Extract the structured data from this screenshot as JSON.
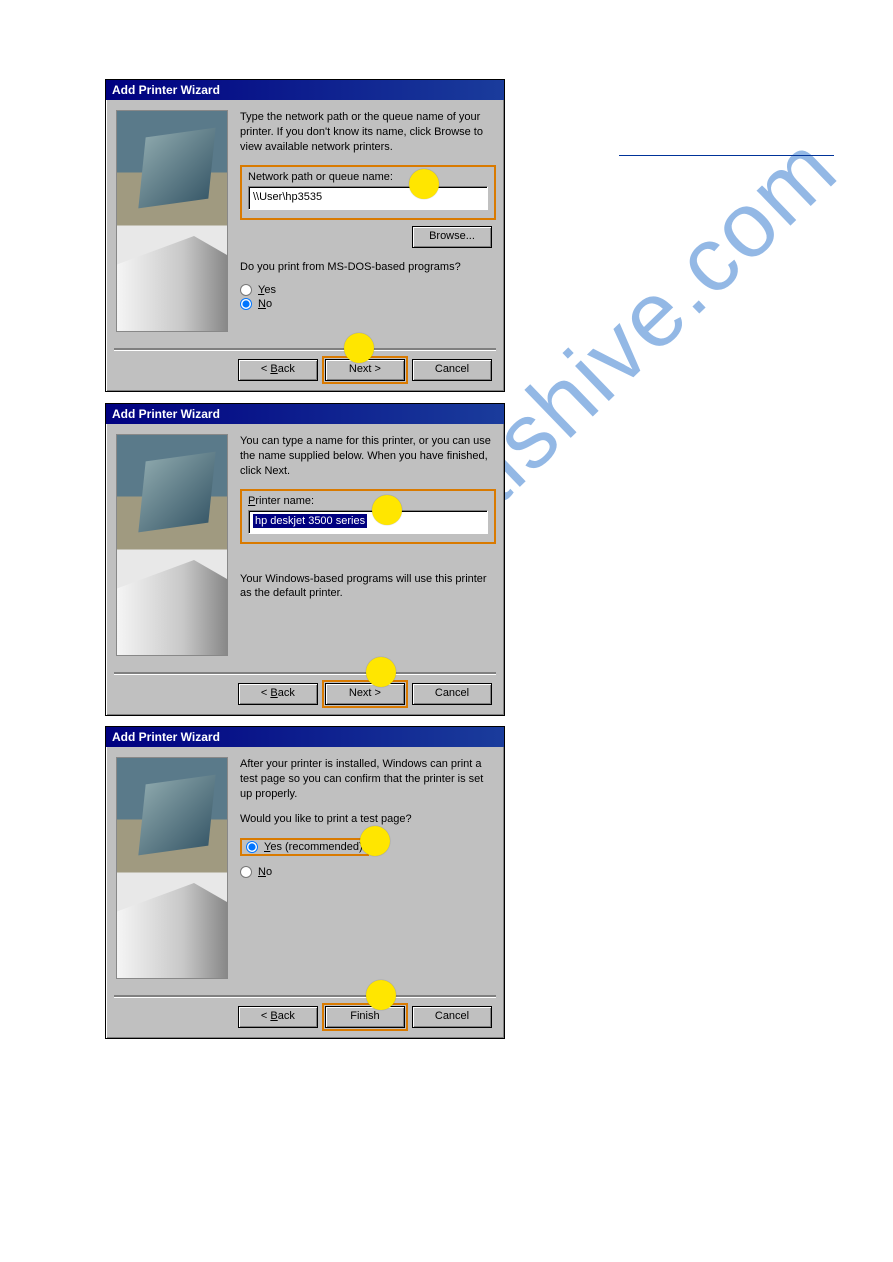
{
  "watermark": "manualshive.com",
  "dialogs": [
    {
      "title": "Add Printer Wizard",
      "desc": "Type the network path or the queue name of your printer. If you don't know its name, click Browse to view available network printers.",
      "field_label": "Network path or queue name:",
      "field_value": "\\\\User\\hp3535",
      "browse": "Browse...",
      "question": "Do you print from MS-DOS-based programs?",
      "radio_yes": "Yes",
      "radio_no": "No",
      "back": "< Back",
      "next": "Next >",
      "cancel": "Cancel"
    },
    {
      "title": "Add Printer Wizard",
      "desc": "You can type a name for this printer, or you can use the name supplied below. When you have finished, click Next.",
      "field_label": "Printer name:",
      "field_value": "hp deskjet 3500 series",
      "note": "Your Windows-based programs will use this printer as the default printer.",
      "back": "< Back",
      "next": "Next >",
      "cancel": "Cancel"
    },
    {
      "title": "Add Printer Wizard",
      "desc": "After your printer is installed, Windows can print a test page so you can confirm that the printer is set up properly.",
      "question": "Would you like to print a test page?",
      "radio_yes": "Yes (recommended)",
      "radio_no": "No",
      "back": "< Back",
      "finish": "Finish",
      "cancel": "Cancel"
    }
  ]
}
